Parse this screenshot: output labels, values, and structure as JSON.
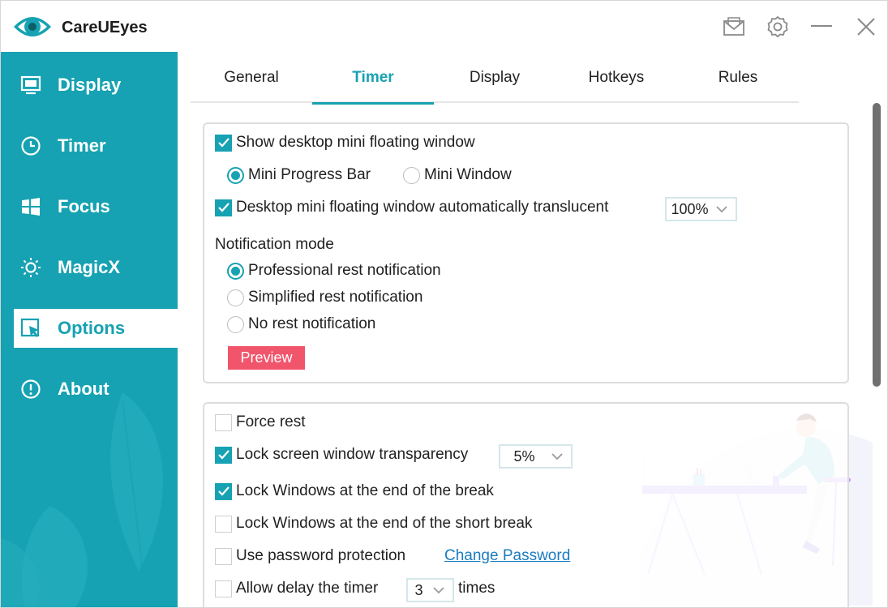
{
  "app": {
    "title": "CareUEyes",
    "brand_color": "#16a2b2",
    "icons": [
      "eye-logo",
      "feedback-mail-icon",
      "settings-gear-icon",
      "minimize-icon",
      "close-icon"
    ]
  },
  "sidebar": {
    "items": [
      {
        "label": "Display",
        "icon": "monitor-icon",
        "active": false
      },
      {
        "label": "Timer",
        "icon": "clock-icon",
        "active": false
      },
      {
        "label": "Focus",
        "icon": "windows-icon",
        "active": false
      },
      {
        "label": "MagicX",
        "icon": "sun-icon",
        "active": false
      },
      {
        "label": "Options",
        "icon": "cursor-icon",
        "active": true
      },
      {
        "label": "About",
        "icon": "info-icon",
        "active": false
      }
    ]
  },
  "tabs": [
    {
      "label": "General",
      "active": false
    },
    {
      "label": "Timer",
      "active": true
    },
    {
      "label": "Display",
      "active": false
    },
    {
      "label": "Hotkeys",
      "active": false
    },
    {
      "label": "Rules",
      "active": false
    }
  ],
  "panel1": {
    "show_mini_window": {
      "label": "Show desktop mini floating window",
      "checked": true
    },
    "mini_type": {
      "options": [
        "Mini Progress Bar",
        "Mini Window"
      ],
      "selected": "Mini Progress Bar"
    },
    "auto_translucent": {
      "label": "Desktop mini floating window automatically translucent",
      "checked": true,
      "value": "100%"
    },
    "notification_heading": "Notification mode",
    "notification_options": [
      "Professional rest notification",
      "Simplified rest notification",
      "No rest notification"
    ],
    "notification_selected": "Professional rest notification",
    "preview_label": "Preview",
    "preview_color": "#f0556c"
  },
  "panel2": {
    "force_rest": {
      "label": "Force rest",
      "checked": false
    },
    "lock_transparency": {
      "label": "Lock screen window transparency",
      "checked": true,
      "value": "5%"
    },
    "lock_end_break": {
      "label": "Lock Windows at the end of the break",
      "checked": true
    },
    "lock_end_short_break": {
      "label": "Lock Windows at the end of the short break",
      "checked": false
    },
    "password_protection": {
      "label": "Use password protection",
      "checked": false,
      "link": "Change Password"
    },
    "allow_delay": {
      "label": "Allow delay the timer",
      "checked": false,
      "value": "3",
      "suffix": "times"
    }
  }
}
